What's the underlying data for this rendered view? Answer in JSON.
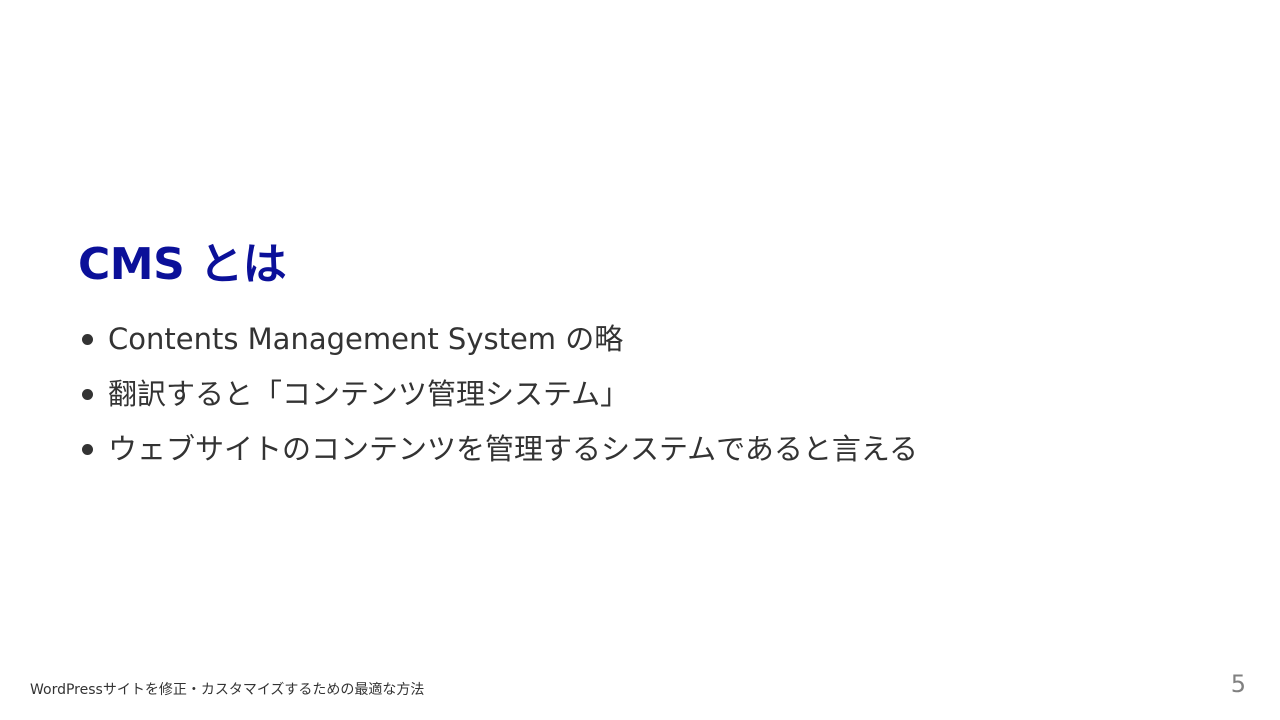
{
  "slide": {
    "title": "CMS とは",
    "bullets": [
      "Contents Management System の略",
      "翻訳すると「コンテンツ管理システム」",
      "ウェブサイトのコンテンツを管理するシステムであると言える"
    ],
    "footer": "WordPressサイトを修正・カスタマイズするための最適な方法",
    "page_number": "5"
  },
  "colors": {
    "title": "#0b1099",
    "text": "#333333",
    "page_number": "#808080",
    "background": "#ffffff"
  }
}
